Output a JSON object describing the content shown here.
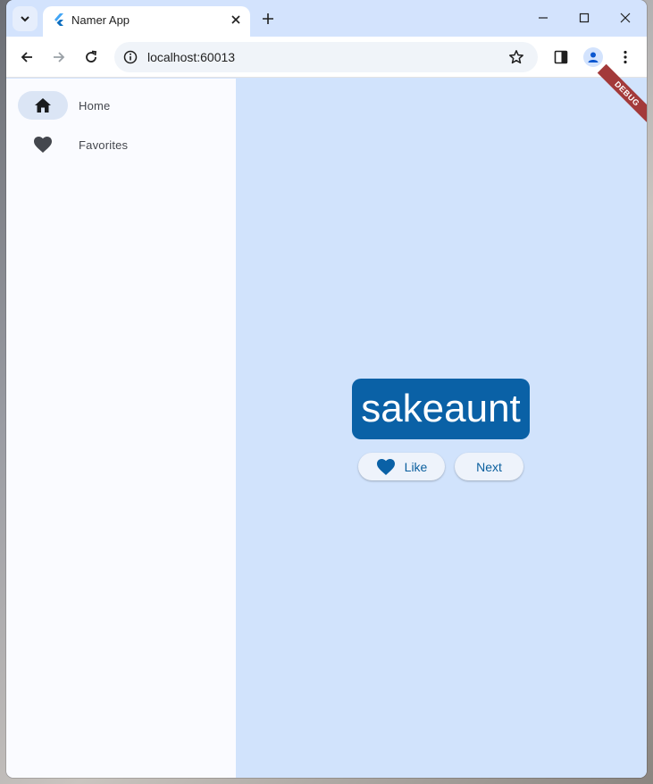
{
  "browser": {
    "tab": {
      "title": "Namer App"
    },
    "address_bar": {
      "url": "localhost:60013"
    }
  },
  "app": {
    "nav": {
      "items": [
        {
          "label": "Home",
          "icon": "home-icon",
          "selected": true
        },
        {
          "label": "Favorites",
          "icon": "heart-icon",
          "selected": false
        }
      ]
    },
    "main": {
      "word": "sakeaunt",
      "like_label": "Like",
      "next_label": "Next"
    },
    "debug_banner": "DEBUG"
  },
  "colors": {
    "accent": "#0a61a6",
    "main_background": "#d1e3fc",
    "nav_background": "#fafbff",
    "nav_selected": "#dbe5f5",
    "debug_banner": "#a33a3a"
  }
}
